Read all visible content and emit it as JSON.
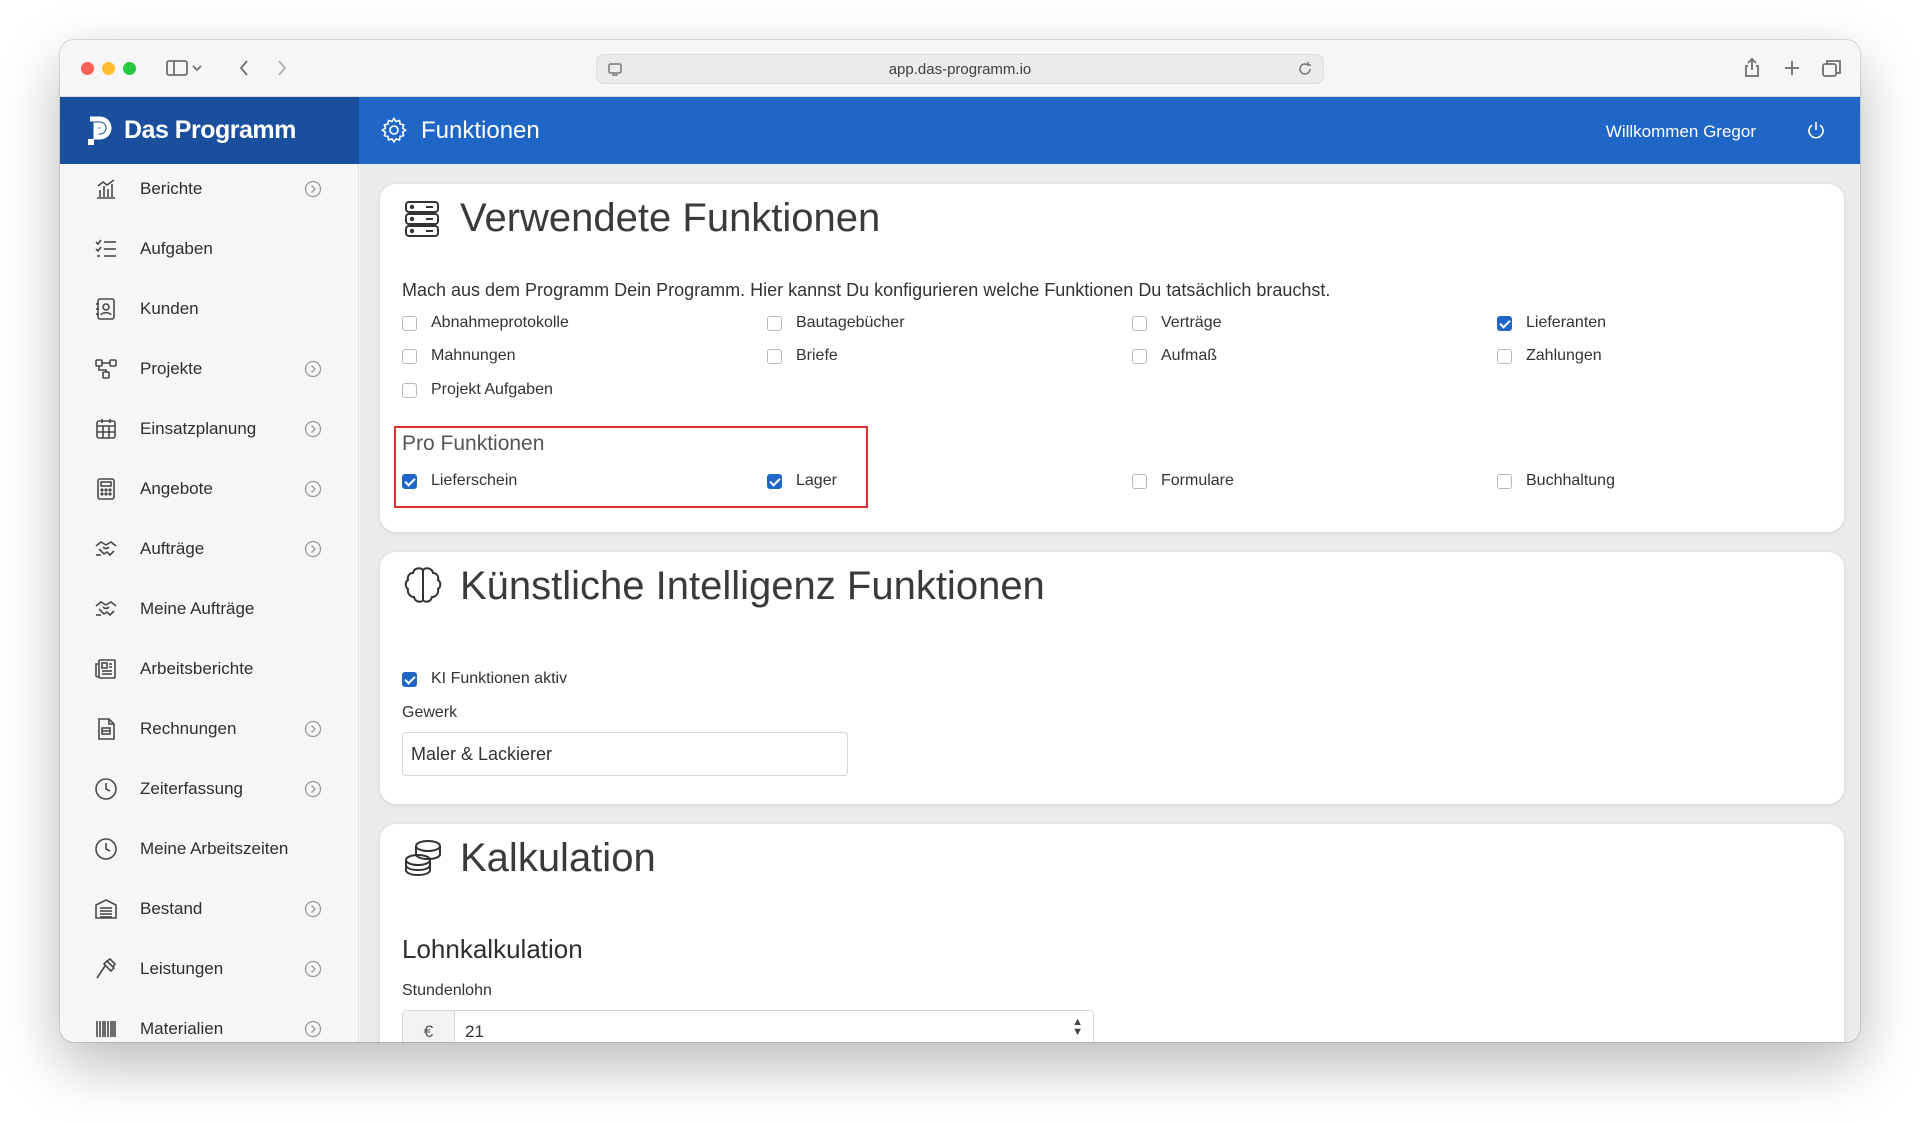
{
  "browser": {
    "url": "app.das-programm.io"
  },
  "app": {
    "logo_text": "Das Programm",
    "page_title": "Funktionen",
    "welcome": "Willkommen Gregor"
  },
  "sidebar": {
    "items": [
      {
        "label": "Berichte",
        "icon": "chart-icon",
        "has_chevron": true
      },
      {
        "label": "Aufgaben",
        "icon": "tasks-icon",
        "has_chevron": false
      },
      {
        "label": "Kunden",
        "icon": "contact-icon",
        "has_chevron": false
      },
      {
        "label": "Projekte",
        "icon": "projects-icon",
        "has_chevron": true
      },
      {
        "label": "Einsatzplanung",
        "icon": "calendar-icon",
        "has_chevron": true
      },
      {
        "label": "Angebote",
        "icon": "calculator-icon",
        "has_chevron": true
      },
      {
        "label": "Aufträge",
        "icon": "handshake-icon",
        "has_chevron": true
      },
      {
        "label": "Meine Aufträge",
        "icon": "handshake-icon",
        "has_chevron": false
      },
      {
        "label": "Arbeitsberichte",
        "icon": "newspaper-icon",
        "has_chevron": false
      },
      {
        "label": "Rechnungen",
        "icon": "invoice-icon",
        "has_chevron": true
      },
      {
        "label": "Zeiterfassung",
        "icon": "clock-icon",
        "has_chevron": true
      },
      {
        "label": "Meine Arbeitszeiten",
        "icon": "clock-icon",
        "has_chevron": false
      },
      {
        "label": "Bestand",
        "icon": "warehouse-icon",
        "has_chevron": true
      },
      {
        "label": "Leistungen",
        "icon": "hammer-icon",
        "has_chevron": true
      },
      {
        "label": "Materialien",
        "icon": "barcode-icon",
        "has_chevron": true
      }
    ]
  },
  "functions_card": {
    "title": "Verwendete Funktionen",
    "description": "Mach aus dem Programm Dein Programm. Hier kannst Du konfigurieren welche Funktionen Du tatsächlich brauchst.",
    "options": [
      {
        "label": "Abnahmeprotokolle",
        "checked": false
      },
      {
        "label": "Bautagebücher",
        "checked": false
      },
      {
        "label": "Verträge",
        "checked": false
      },
      {
        "label": "Lieferanten",
        "checked": true
      },
      {
        "label": "Mahnungen",
        "checked": false
      },
      {
        "label": "Briefe",
        "checked": false
      },
      {
        "label": "Aufmaß",
        "checked": false
      },
      {
        "label": "Zahlungen",
        "checked": false
      },
      {
        "label": "Projekt Aufgaben",
        "checked": false
      }
    ],
    "pro_title": "Pro Funktionen",
    "pro_options": [
      {
        "label": "Lieferschein",
        "checked": true
      },
      {
        "label": "Lager",
        "checked": true
      },
      {
        "label": "Formulare",
        "checked": false
      },
      {
        "label": "Buchhaltung",
        "checked": false
      }
    ]
  },
  "ai_card": {
    "title": "Künstliche Intelligenz Funktionen",
    "ai_active_label": "KI Funktionen aktiv",
    "ai_active_checked": true,
    "trade_label": "Gewerk",
    "trade_value": "Maler & Lackierer"
  },
  "calc_card": {
    "title": "Kalkulation",
    "subtitle": "Lohnkalkulation",
    "wage_label": "Stundenlohn",
    "wage_prefix": "€",
    "wage_value": "21"
  },
  "colors": {
    "header_blue": "#1f66c7",
    "logo_blue": "#1a4f9e",
    "checkbox_blue": "#1f66c7",
    "highlight_red": "#e0302c"
  }
}
